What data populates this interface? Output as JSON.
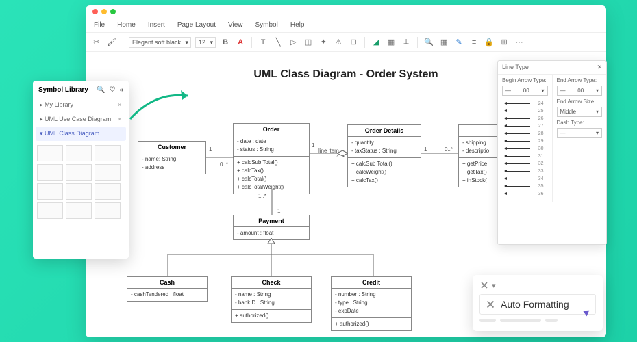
{
  "menu": {
    "file": "File",
    "home": "Home",
    "insert": "Insert",
    "page_layout": "Page Layout",
    "view": "View",
    "symbol": "Symbol",
    "help": "Help"
  },
  "toolbar": {
    "font_name": "Elegant soft black",
    "font_size": "12"
  },
  "canvas": {
    "title": "UML Class Diagram - Order System",
    "customer": {
      "name": "Customer",
      "a1": "- name: String",
      "a2": "- address"
    },
    "order": {
      "name": "Order",
      "a1": "- date : date",
      "a2": "- status : String",
      "m1": "+ calcSub Total()",
      "m2": "+ calcTax()",
      "m3": "+ calcTotal()",
      "m4": "+ calcTotalWeight()"
    },
    "details": {
      "name": "Order Details",
      "a1": "- quantity",
      "a2": "- taxStatus : String",
      "m1": "+ calcSub Total()",
      "m2": "+ calcWeight()",
      "m3": "+ calcTax()"
    },
    "right": {
      "a1": "- shipping",
      "a2": "- descriptio",
      "m1": "+ getPrice",
      "m2": "+ getTax()",
      "m3": "+ inStock("
    },
    "payment": {
      "name": "Payment",
      "a1": "- amount : float"
    },
    "cash": {
      "name": "Cash",
      "a1": "- cashTendered : float"
    },
    "check": {
      "name": "Check",
      "a1": "- name : String",
      "a2": "- bankID : String",
      "m1": "+ authorized()"
    },
    "credit": {
      "name": "Credit",
      "a1": "- number : String",
      "a2": "- type : String",
      "a3": "- expDate",
      "m1": "+ authorized()"
    },
    "labels": {
      "one_a": "1",
      "zero_star_a": "0..*",
      "one_b": "1",
      "line_item": "line item",
      "one_star_b": "1..*",
      "one_c": "1",
      "zero_star_c": "0..*",
      "one_star_d": "1..*",
      "one_d": "1"
    }
  },
  "sidebar": {
    "title": "Symbol Library",
    "items": [
      {
        "label": "My Library",
        "closable": true
      },
      {
        "label": "UML Use Case Diagram",
        "closable": true
      },
      {
        "label": "UML Class Diagram",
        "active": true
      }
    ]
  },
  "linetype": {
    "title": "Line Type",
    "begin_label": "Begin Arrow Type:",
    "end_label": "End Arrow Type:",
    "size_label": "End Arrow Size:",
    "dash_label": "Dash Type:",
    "val_00": "00",
    "val_middle": "Middle",
    "rows": [
      24,
      25,
      26,
      27,
      28,
      29,
      30,
      31,
      32,
      33,
      34,
      35,
      36
    ]
  },
  "autofmt": {
    "label": "Auto Formatting"
  }
}
